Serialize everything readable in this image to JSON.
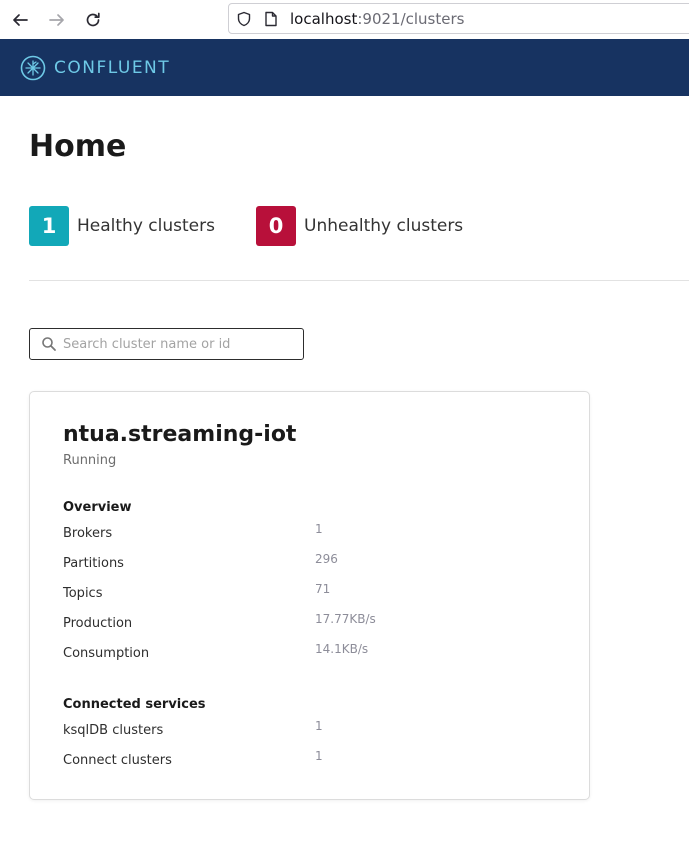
{
  "browser": {
    "url_host": "localhost",
    "url_path": ":9021/clusters"
  },
  "header": {
    "brand": "CONFLUENT"
  },
  "page": {
    "title": "Home"
  },
  "stats": {
    "healthy": {
      "count": "1",
      "label": "Healthy clusters",
      "color": "#12a8b8"
    },
    "unhealthy": {
      "count": "0",
      "label": "Unhealthy clusters",
      "color": "#b8103a"
    }
  },
  "search": {
    "placeholder": "Search cluster name or id",
    "value": ""
  },
  "cluster": {
    "name": "ntua.streaming-iot",
    "status": "Running",
    "overview_heading": "Overview",
    "overview": [
      {
        "label": "Brokers",
        "value": "1"
      },
      {
        "label": "Partitions",
        "value": "296"
      },
      {
        "label": "Topics",
        "value": "71"
      },
      {
        "label": "Production",
        "value": "17.77KB/s"
      },
      {
        "label": "Consumption",
        "value": "14.1KB/s"
      }
    ],
    "services_heading": "Connected services",
    "services": [
      {
        "label": "ksqlDB clusters",
        "value": "1"
      },
      {
        "label": "Connect clusters",
        "value": "1"
      }
    ]
  }
}
